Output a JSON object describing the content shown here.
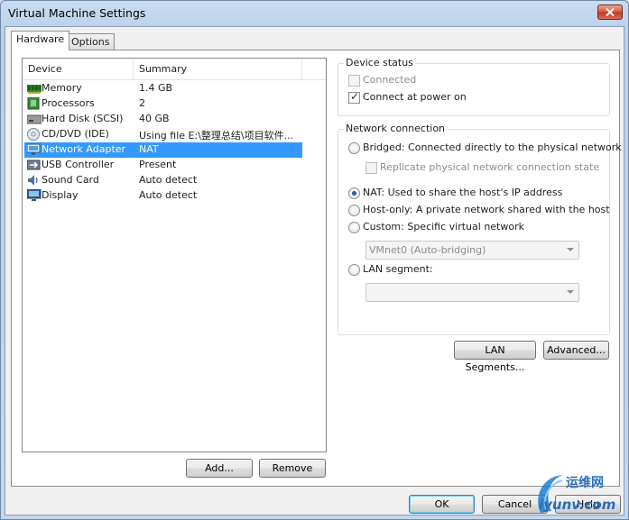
{
  "window": {
    "title": "Virtual Machine Settings"
  },
  "tabs": [
    {
      "label": "Hardware",
      "active": true
    },
    {
      "label": "Options",
      "active": false
    }
  ],
  "device_list": {
    "columns": [
      "Device",
      "Summary"
    ],
    "rows": [
      {
        "device": "Memory",
        "summary": "1.4 GB",
        "icon": "memory-icon"
      },
      {
        "device": "Processors",
        "summary": "2",
        "icon": "processor-icon"
      },
      {
        "device": "Hard Disk (SCSI)",
        "summary": "40 GB",
        "icon": "hard-disk-icon"
      },
      {
        "device": "CD/DVD (IDE)",
        "summary": "Using file E:\\整理总结\\项目软件...",
        "icon": "cd-dvd-icon"
      },
      {
        "device": "Network Adapter",
        "summary": "NAT",
        "icon": "network-adapter-icon",
        "selected": true
      },
      {
        "device": "USB Controller",
        "summary": "Present",
        "icon": "usb-icon"
      },
      {
        "device": "Sound Card",
        "summary": "Auto detect",
        "icon": "sound-card-icon"
      },
      {
        "device": "Display",
        "summary": "Auto detect",
        "icon": "display-icon"
      }
    ]
  },
  "list_buttons": {
    "add": "Add...",
    "remove": "Remove"
  },
  "device_status": {
    "title": "Device status",
    "connected": {
      "label": "Connected",
      "checked": false,
      "enabled": false
    },
    "connect_at_power_on": {
      "label": "Connect at power on",
      "checked": true,
      "enabled": true
    }
  },
  "network_connection": {
    "title": "Network connection",
    "bridged": {
      "label": "Bridged: Connected directly to the physical network",
      "selected": false
    },
    "replicate": {
      "label": "Replicate physical network connection state",
      "checked": false,
      "enabled": false
    },
    "nat": {
      "label": "NAT: Used to share the host's IP address",
      "selected": true
    },
    "host_only": {
      "label": "Host-only: A private network shared with the host",
      "selected": false
    },
    "custom": {
      "label": "Custom: Specific virtual network",
      "selected": false
    },
    "custom_select": {
      "value": "VMnet0 (Auto-bridging)"
    },
    "lan_segment": {
      "label": "LAN segment:",
      "selected": false
    },
    "lan_segment_select": {
      "value": ""
    }
  },
  "network_buttons": {
    "lan_segments": "LAN Segments...",
    "advanced": "Advanced..."
  },
  "footer": {
    "ok": "OK",
    "cancel": "Cancel",
    "help": "Help"
  },
  "watermark": {
    "line1": "运维网",
    "line2": "iyunv.com"
  },
  "colors": {
    "selection": "#3399ff",
    "window_frame": "#b9cfe8",
    "close_button": "#c4371f"
  }
}
